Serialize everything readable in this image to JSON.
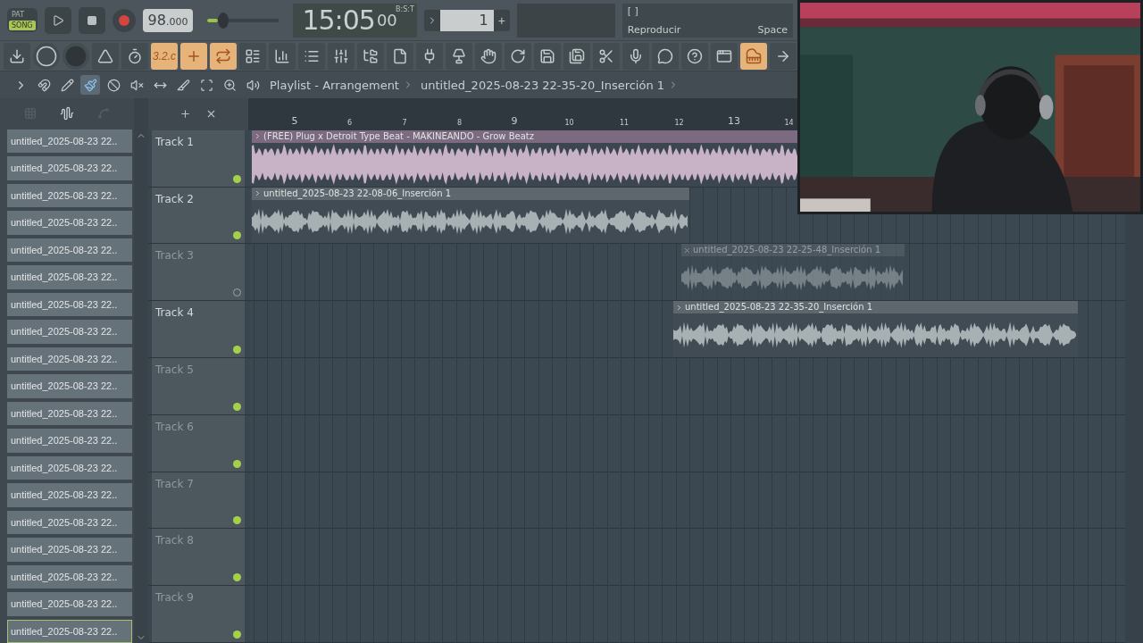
{
  "transport": {
    "modes": [
      {
        "label": "PAT",
        "selected": false
      },
      {
        "label": "SONG",
        "selected": true
      }
    ],
    "tempo": {
      "whole": "98",
      "fraction": ".000"
    },
    "master_volume": {
      "level": 0.15
    },
    "time": {
      "main": "15:05",
      "sub": "00",
      "unit": "B:S:T"
    },
    "pattern": {
      "value": "1",
      "add": "+"
    },
    "hint": {
      "keys": "[ ]",
      "text": "Reproducir",
      "shortcut": "Space"
    }
  },
  "toolbar": [
    {
      "kind": "download",
      "active": false
    },
    {
      "kind": "knob",
      "active": false
    },
    {
      "kind": "knob-dark",
      "active": false
    },
    {
      "kind": "metronome",
      "active": false
    },
    {
      "kind": "wait",
      "active": false
    },
    {
      "kind": "typing",
      "label": "3.2.c",
      "active": true
    },
    {
      "kind": "blend",
      "active": true
    },
    {
      "kind": "loop",
      "active": true
    },
    {
      "kind": "playlist",
      "active": false
    },
    {
      "kind": "step",
      "active": false
    },
    {
      "kind": "channels",
      "active": false
    },
    {
      "kind": "mixer",
      "active": false
    },
    {
      "kind": "browser",
      "active": false
    },
    {
      "kind": "file",
      "active": false
    },
    {
      "kind": "plugin",
      "active": false
    },
    {
      "kind": "lamp",
      "active": false
    },
    {
      "kind": "hand",
      "active": false
    },
    {
      "kind": "undo",
      "active": false
    },
    {
      "kind": "save",
      "active": false
    },
    {
      "kind": "render",
      "active": false
    },
    {
      "kind": "cut",
      "active": false
    },
    {
      "kind": "mic",
      "active": false
    },
    {
      "kind": "chat",
      "active": false
    },
    {
      "kind": "help",
      "active": false
    },
    {
      "kind": "window",
      "active": false
    },
    {
      "kind": "piano",
      "active": true
    },
    {
      "kind": "next",
      "active": false
    }
  ],
  "playlist_bar": {
    "tools": [
      {
        "kind": "play",
        "selected": false
      },
      {
        "kind": "magnet",
        "selected": false
      },
      {
        "kind": "pencil",
        "selected": false
      },
      {
        "kind": "brush",
        "selected": true
      },
      {
        "kind": "delete",
        "selected": false
      },
      {
        "kind": "mute",
        "selected": false
      },
      {
        "kind": "slip",
        "selected": false
      },
      {
        "kind": "slice",
        "selected": false
      },
      {
        "kind": "select",
        "selected": false
      },
      {
        "kind": "zoom",
        "selected": false
      },
      {
        "kind": "playback",
        "selected": false
      }
    ],
    "title": "Playlist - Arrangement",
    "clip": "untitled_2025-08-23 22-35-20_Inserción 1"
  },
  "browser": {
    "items": [
      {
        "label": "untitled_2025-08-23 22..",
        "selected": false
      },
      {
        "label": "untitled_2025-08-23 22..",
        "selected": false
      },
      {
        "label": "untitled_2025-08-23 22..",
        "selected": false
      },
      {
        "label": "untitled_2025-08-23 22..",
        "selected": false
      },
      {
        "label": "untitled_2025-08-23 22..",
        "selected": false
      },
      {
        "label": "untitled_2025-08-23 22..",
        "selected": false
      },
      {
        "label": "untitled_2025-08-23 22..",
        "selected": false
      },
      {
        "label": "untitled_2025-08-23 22..",
        "selected": false
      },
      {
        "label": "untitled_2025-08-23 22..",
        "selected": false
      },
      {
        "label": "untitled_2025-08-23 22..",
        "selected": false
      },
      {
        "label": "untitled_2025-08-23 22..",
        "selected": false
      },
      {
        "label": "untitled_2025-08-23 22..",
        "selected": false
      },
      {
        "label": "untitled_2025-08-23 22..",
        "selected": false
      },
      {
        "label": "untitled_2025-08-23 22..",
        "selected": false
      },
      {
        "label": "untitled_2025-08-23 22..",
        "selected": false
      },
      {
        "label": "untitled_2025-08-23 22..",
        "selected": false
      },
      {
        "label": "untitled_2025-08-23 22..",
        "selected": false
      },
      {
        "label": "untitled_2025-08-23 22..",
        "selected": false
      },
      {
        "label": "untitled_2025-08-23 22..",
        "selected": true
      }
    ]
  },
  "ruler": [
    "5",
    "6",
    "7",
    "8",
    "9",
    "10",
    "11",
    "12",
    "13",
    "14"
  ],
  "tracks": [
    {
      "name": "Track 1",
      "muted": false,
      "clips": [
        {
          "kind": "beat",
          "title": "(FREE) Plug x Detroit Type Beat - MAKINEANDO - Grow Beatz",
          "muted": false
        }
      ]
    },
    {
      "name": "Track 2",
      "muted": false,
      "clips": [
        {
          "kind": "vocal",
          "title": "untitled_2025-08-23 22-08-06_Inserción 1",
          "muted": false
        }
      ]
    },
    {
      "name": "Track 3",
      "muted": true,
      "clips": [
        {
          "kind": "vocal",
          "title": "untitled_2025-08-23 22-25-48_Inserción 1",
          "muted": true
        }
      ]
    },
    {
      "name": "Track 4",
      "muted": false,
      "clips": [
        {
          "kind": "vocal",
          "title": "untitled_2025-08-23 22-35-20_Inserción 1",
          "muted": false
        }
      ]
    },
    {
      "name": "Track 5",
      "muted": false
    },
    {
      "name": "Track 6",
      "muted": false
    },
    {
      "name": "Track 7",
      "muted": false
    },
    {
      "name": "Track 8",
      "muted": false
    },
    {
      "name": "Track 9",
      "muted": false
    }
  ],
  "webcam": {
    "kind": "picture"
  }
}
